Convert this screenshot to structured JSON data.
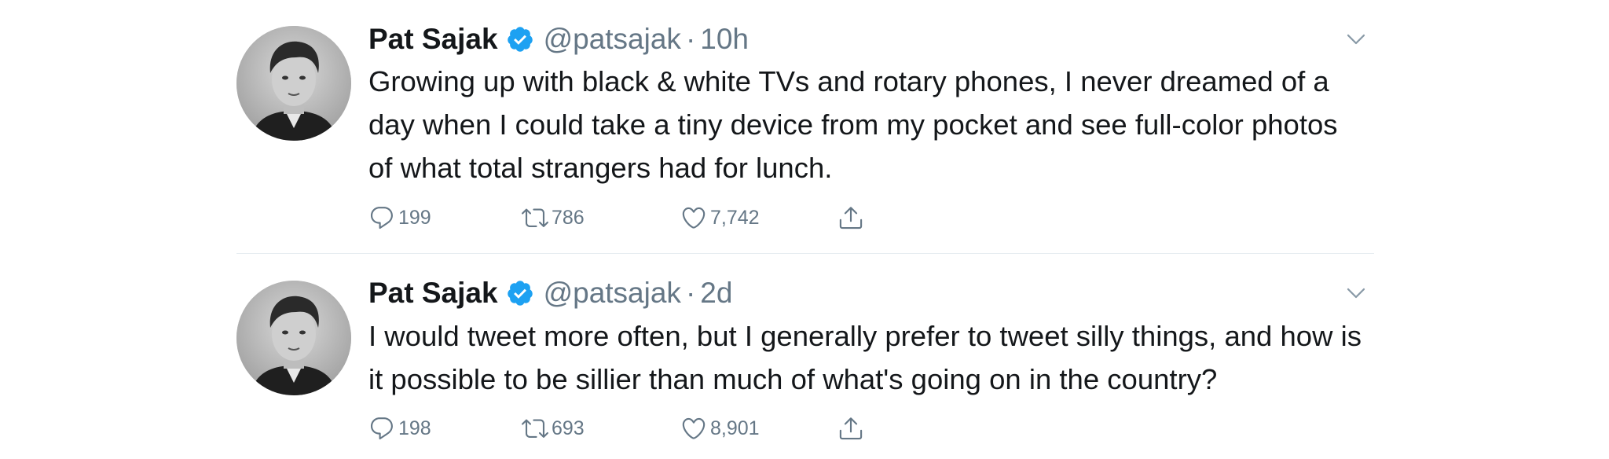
{
  "tweets": [
    {
      "display_name": "Pat Sajak",
      "handle": "@patsajak",
      "separator": "·",
      "time": "10h",
      "text": "Growing up with black & white TVs and rotary phones, I never dreamed of a day when I could take a tiny device from my pocket and see full-color photos of what total strangers had for lunch.",
      "replies": "199",
      "retweets": "786",
      "likes": "7,742"
    },
    {
      "display_name": "Pat Sajak",
      "handle": "@patsajak",
      "separator": "·",
      "time": "2d",
      "text": "I would tweet more often, but I generally prefer to tweet silly things, and how is it possible to be sillier than much of what's going on in the country?",
      "replies": "198",
      "retweets": "693",
      "likes": "8,901"
    }
  ],
  "icons": {
    "verified": "verified-badge-icon",
    "caret": "chevron-down-icon",
    "reply": "reply-icon",
    "retweet": "retweet-icon",
    "like": "heart-icon",
    "share": "share-icon"
  },
  "colors": {
    "verified_blue": "#1da1f2",
    "text_primary": "#14171a",
    "text_secondary": "#657786",
    "divider": "#e6ecf0"
  }
}
